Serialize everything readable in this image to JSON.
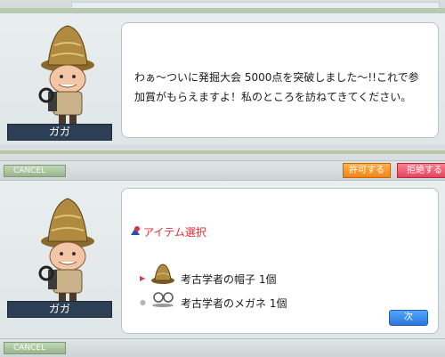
{
  "dialog1": {
    "npc_name": "ガガ",
    "message_line1": "わぁ〜ついに発掘大会 5000点を突破しました〜!!これで参",
    "message_line2": "加賞がもらえますよ！私のところを訪ねてきてください。"
  },
  "bar": {
    "cancel_label": "CANCEL",
    "accept_label": "許可する",
    "decline_label": "拒絶する"
  },
  "dialog2": {
    "npc_name": "ガガ",
    "select_title": "アイテム選択",
    "options": [
      {
        "label": "考古学者の帽子 1個",
        "icon": "archaeologist-hat-icon"
      },
      {
        "label": "考古学者のメガネ 1個",
        "icon": "archaeologist-glasses-icon"
      }
    ],
    "next_label": "次"
  },
  "bottom_bar": {
    "cancel_label": "CANCEL"
  },
  "colors": {
    "name_bg": "#2d3f55",
    "select_title": "#e0313d",
    "accept": "#f0841b",
    "decline": "#e14660",
    "next": "#2b76d9"
  }
}
